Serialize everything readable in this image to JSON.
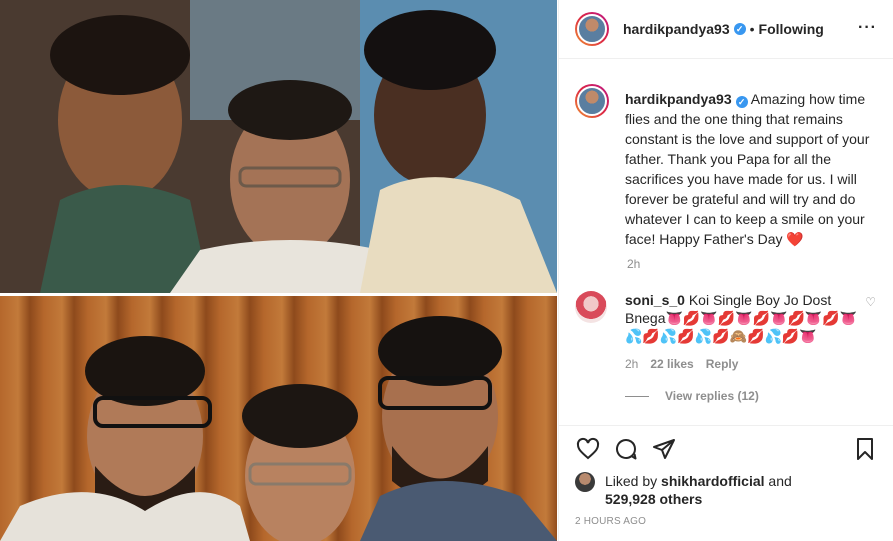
{
  "post": {
    "username": "hardikpandya93",
    "follow_status": "Following",
    "more_icon": "more-horizontal-icon"
  },
  "caption": {
    "username": "hardikpandya93",
    "text": "Amazing how time flies and the one thing that remains constant is the love and support of your father. Thank you Papa for all the sacrifices you have made for us. I will forever be grateful and will try and do whatever I can to keep a smile on your face! Happy Father's Day",
    "emoji": "❤️",
    "time": "2h"
  },
  "comments": [
    {
      "username": "soni_s_0",
      "text": "Koi Single Boy Jo Dost Bnega👅💋👅💋👅💋👅💋👅💋👅💦💋💦💋💦💋🙈💋💦💋👅",
      "time": "2h",
      "likes": "22 likes",
      "reply": "Reply",
      "view_replies": "View replies (12)"
    }
  ],
  "actions": {
    "like_icon": "heart-icon",
    "comment_icon": "comment-icon",
    "share_icon": "share-icon",
    "save_icon": "bookmark-icon"
  },
  "likes": {
    "prefix": "Liked by",
    "user": "shikhardofficial",
    "joiner": "and",
    "others": "529,928 others"
  },
  "date": "2 HOURS AGO"
}
